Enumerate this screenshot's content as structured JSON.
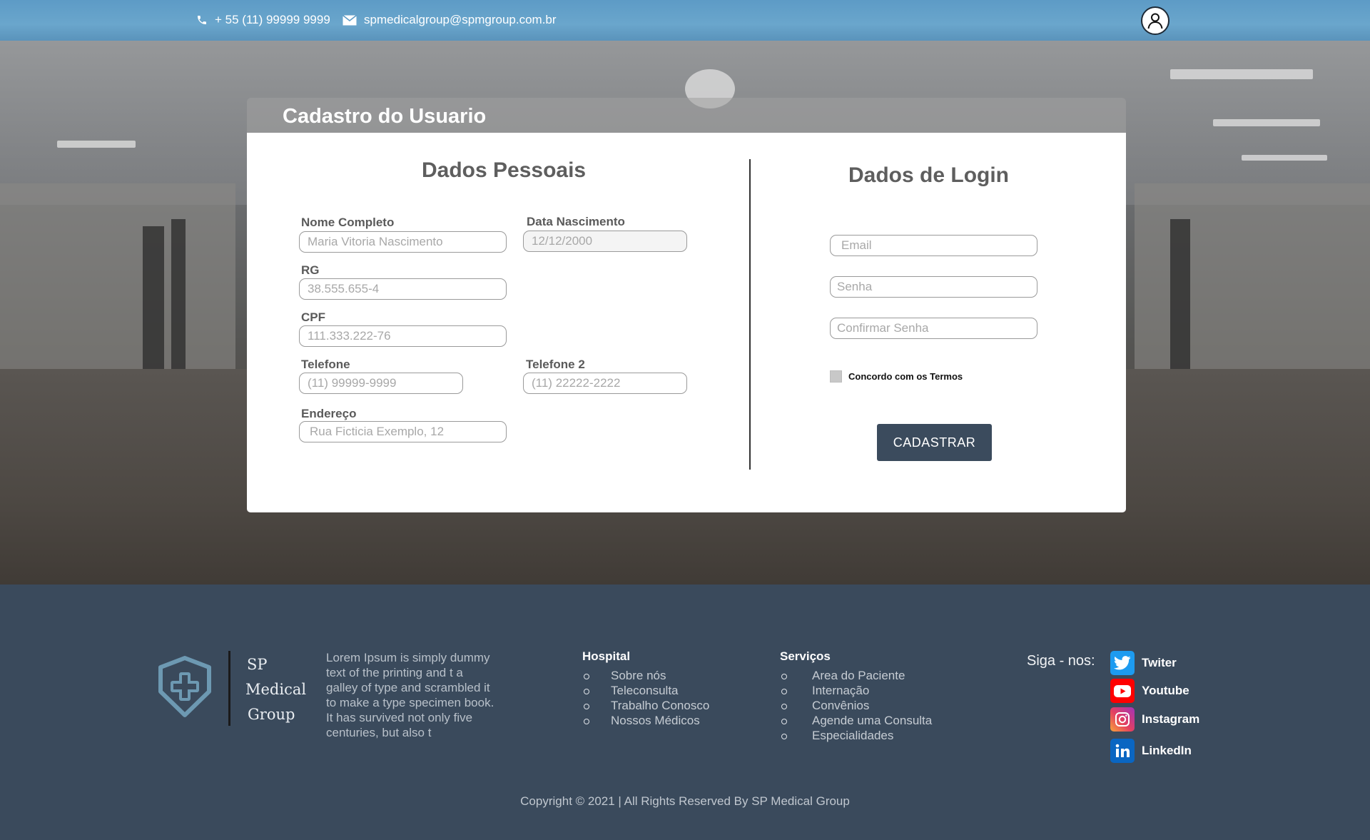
{
  "topbar": {
    "phone": "+ 55 (11) 99999 9999",
    "email": "spmedicalgroup@spmgroup.com.br",
    "icons": [
      "phone-icon",
      "mail-icon",
      "user-icon"
    ]
  },
  "card": {
    "title": "Cadastro do Usuario",
    "personal": {
      "heading": "Dados Pessoais",
      "fields": {
        "nome": {
          "label": "Nome Completo",
          "placeholder": "Maria Vitoria Nascimento"
        },
        "nascimento": {
          "label": "Data Nascimento",
          "value": "12/12/2000"
        },
        "rg": {
          "label": "RG",
          "placeholder": "38.555.655-4"
        },
        "cpf": {
          "label": "CPF",
          "placeholder": "111.333.222-76"
        },
        "telefone": {
          "label": "Telefone",
          "placeholder": "(11) 99999-9999"
        },
        "telefone2": {
          "label": "Telefone 2",
          "placeholder": "(11) 22222-2222"
        },
        "endereco": {
          "label": "Endereço",
          "placeholder": "Rua Ficticia Exemplo, 12"
        }
      }
    },
    "login": {
      "heading": "Dados de Login",
      "email_placeholder": "Email",
      "senha_placeholder": "Senha",
      "confirmar_placeholder": "Confirmar Senha",
      "terms_label": "Concordo com os Termos",
      "submit_label": "CADASTRAR"
    }
  },
  "footer": {
    "logo": {
      "line1": "SP",
      "line2": "Medical",
      "line3": "Group"
    },
    "lorem": "Lorem Ipsum is simply dummy text of the printing and t a galley of type and scrambled it to make a type specimen book. It has survived not only five centuries, but also t",
    "hospital": {
      "title": "Hospital",
      "items": [
        "Sobre nós",
        "Teleconsulta",
        "Trabalho Conosco",
        "Nossos Médicos"
      ]
    },
    "servicos": {
      "title": "Serviços",
      "items": [
        "Area do Paciente",
        "Internação",
        "Convênios",
        "Agende uma Consulta",
        "Especialidades"
      ]
    },
    "siga": "Siga - nos:",
    "social": [
      {
        "label": "Twiter",
        "icon": "twitter-icon",
        "color": "#1d9bf0"
      },
      {
        "label": "Youtube",
        "icon": "youtube-icon",
        "color": "#ff0000"
      },
      {
        "label": "Instagram",
        "icon": "instagram-icon",
        "color": "#d6249f"
      },
      {
        "label": "LinkedIn",
        "icon": "linkedin-icon",
        "color": "#0a66c2"
      }
    ],
    "copyright": "Copyright © 2021 | All Rights Reserved By SP Medical Group"
  },
  "colors": {
    "topbar": "#5d9bc6",
    "footer": "#3a4a5c",
    "button": "#3b4b5d"
  }
}
